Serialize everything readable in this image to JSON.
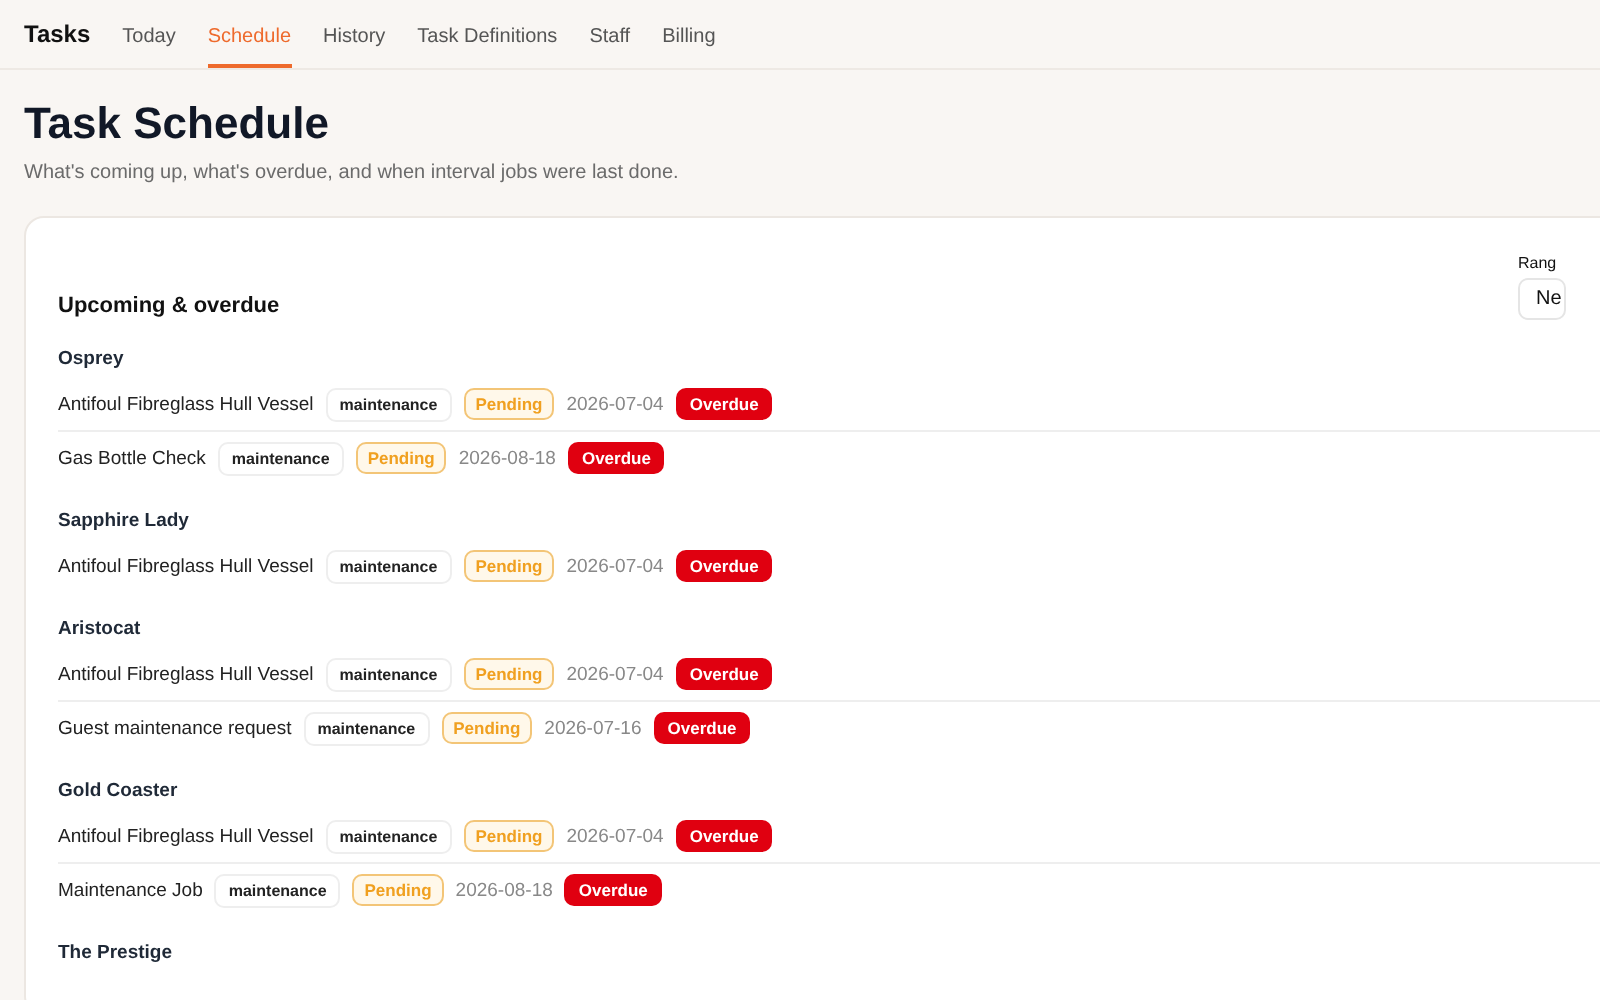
{
  "nav": {
    "brand": "Tasks",
    "tabs": [
      {
        "label": "Today",
        "selected": false
      },
      {
        "label": "Schedule",
        "selected": true
      },
      {
        "label": "History",
        "selected": false
      },
      {
        "label": "Task Definitions",
        "selected": false
      },
      {
        "label": "Staff",
        "selected": false
      },
      {
        "label": "Billing",
        "selected": false
      }
    ]
  },
  "page": {
    "title": "Task Schedule",
    "subtitle": "What's coming up, what's overdue, and when interval jobs were last done."
  },
  "card": {
    "title": "Upcoming & overdue",
    "range_label": "Rang",
    "range_value": "Ne",
    "groups": [
      {
        "name": "Osprey",
        "tasks": [
          {
            "name": "Antifoul Fibreglass Hull Vessel",
            "category": "maintenance",
            "status": "Pending",
            "date": "2026-07-04",
            "flag": "Overdue"
          },
          {
            "name": "Gas Bottle Check",
            "category": "maintenance",
            "status": "Pending",
            "date": "2026-08-18",
            "flag": "Overdue"
          }
        ]
      },
      {
        "name": "Sapphire Lady",
        "tasks": [
          {
            "name": "Antifoul Fibreglass Hull Vessel",
            "category": "maintenance",
            "status": "Pending",
            "date": "2026-07-04",
            "flag": "Overdue"
          }
        ]
      },
      {
        "name": "Aristocat",
        "tasks": [
          {
            "name": "Antifoul Fibreglass Hull Vessel",
            "category": "maintenance",
            "status": "Pending",
            "date": "2026-07-04",
            "flag": "Overdue"
          },
          {
            "name": "Guest maintenance request",
            "category": "maintenance",
            "status": "Pending",
            "date": "2026-07-16",
            "flag": "Overdue"
          }
        ]
      },
      {
        "name": "Gold Coaster",
        "tasks": [
          {
            "name": "Antifoul Fibreglass Hull Vessel",
            "category": "maintenance",
            "status": "Pending",
            "date": "2026-07-04",
            "flag": "Overdue"
          },
          {
            "name": "Maintenance Job",
            "category": "maintenance",
            "status": "Pending",
            "date": "2026-08-18",
            "flag": "Overdue"
          }
        ]
      },
      {
        "name": "The Prestige"
      }
    ]
  }
}
